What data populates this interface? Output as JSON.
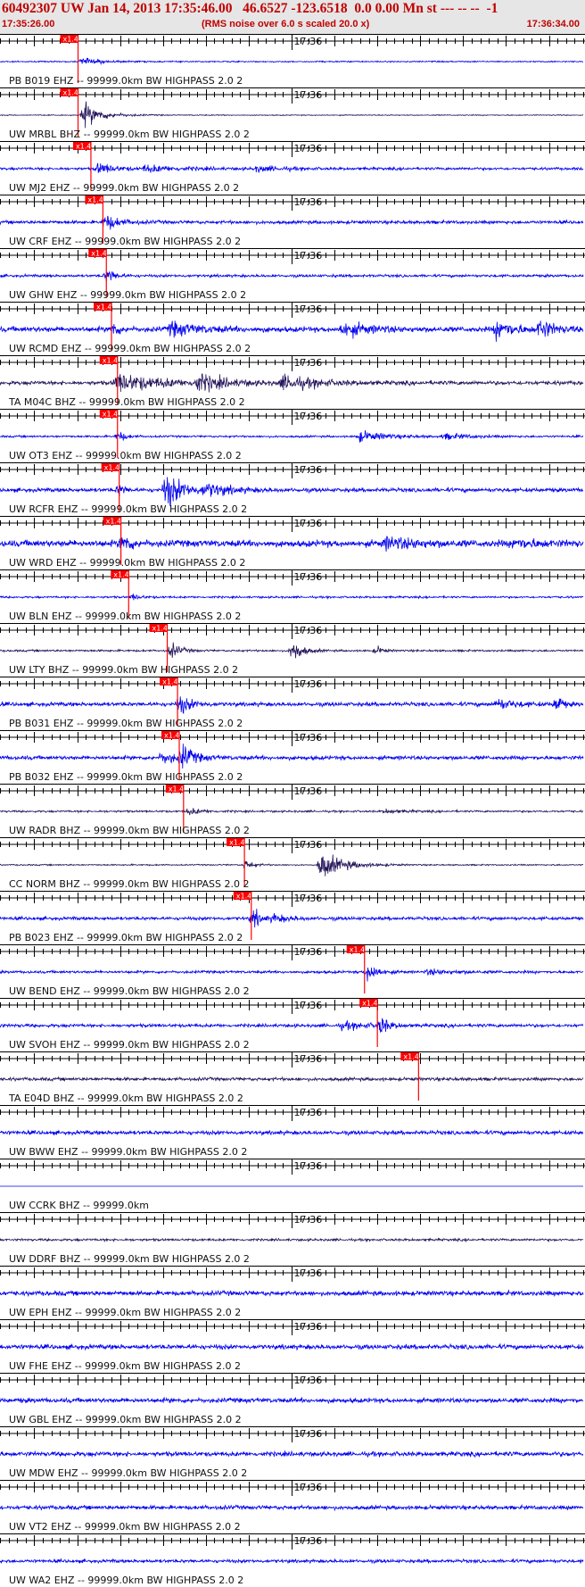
{
  "header": {
    "title": "60492307 UW Jan 14, 2013 17:35:46.00   46.6527 -123.6518  0.0 0.00 Mn st --- -- --  -1",
    "start_time": "17:35:26.00",
    "note": "(RMS noise over 6.0 s scaled 20.0 x)",
    "end_time": "17:36:34.00"
  },
  "colors": {
    "trace_blue": "#0000ee",
    "trace_dark": "#24145a",
    "pick": "#ff0000",
    "header_bg": "#e6e6e6",
    "header_text": "#c00000"
  },
  "chart_data": {
    "type": "line",
    "title": "60492307 UW Jan 14, 2013 17:35:46.00   46.6527 -123.6518  0.0 0.00 Mn st --- -- --  -1",
    "x_start": "17:35:26.00",
    "x_end": "17:36:34.00",
    "x_range_seconds": [
      0,
      68
    ],
    "minute_marker": {
      "label": "17:36",
      "seconds": 34
    },
    "pick_label": "x1.4",
    "grid": false,
    "series": [
      {
        "label": "PB B019 EHZ -- 99999.0km BW  HIGHPASS  2.0  2",
        "color": "blue",
        "noise": 1.0,
        "pick_s": 9.1,
        "bursts": [
          [
            9.6,
            6.0,
            2.0
          ]
        ]
      },
      {
        "label": "UW MRBL BHZ -- 99999.0km BW  HIGHPASS  2.0  2",
        "color": "dark",
        "noise": 0.7,
        "pick_s": 9.1,
        "bursts": [
          [
            9.9,
            18.0,
            2.0
          ]
        ]
      },
      {
        "label": "UW MJ2 EHZ -- 99999.0km BW  HIGHPASS  2.0  2",
        "color": "blue",
        "noise": 2.0,
        "pick_s": 10.6,
        "bursts": [
          [
            11.5,
            8.0,
            2.0
          ],
          [
            17.0,
            5.0,
            4.0
          ],
          [
            30.0,
            4.0,
            3.0
          ]
        ]
      },
      {
        "label": "UW CRF EHZ -- 99999.0km BW  HIGHPASS  2.0  2",
        "color": "blue",
        "noise": 2.5,
        "pick_s": 12.0,
        "bursts": [
          [
            12.3,
            12.0,
            1.5
          ]
        ]
      },
      {
        "label": "UW GHW EHZ -- 99999.0km BW  HIGHPASS  2.0  2",
        "color": "blue",
        "noise": 2.0,
        "pick_s": 12.4,
        "bursts": [
          [
            12.6,
            12.0,
            0.8
          ]
        ]
      },
      {
        "label": "UW RCMD EHZ -- 99999.0km BW  HIGHPASS  2.0  2",
        "color": "blue",
        "noise": 4.0,
        "pick_s": 13.0,
        "bursts": [
          [
            13.2,
            10.0,
            0.8
          ],
          [
            20.0,
            10.0,
            3.0
          ],
          [
            40.0,
            10.0,
            3.0
          ],
          [
            58.0,
            14.0,
            2.0
          ],
          [
            63.0,
            14.0,
            1.5
          ]
        ]
      },
      {
        "label": "TA M04C BHZ -- 99999.0km BW  HIGHPASS  2.0  2",
        "color": "dark",
        "noise": 3.0,
        "pick_s": 13.7,
        "bursts": [
          [
            13.7,
            14.0,
            5.0
          ],
          [
            23.0,
            12.0,
            3.0
          ],
          [
            33.0,
            10.0,
            4.0
          ]
        ]
      },
      {
        "label": "UW OT3 EHZ -- 99999.0km BW  HIGHPASS  2.0  2",
        "color": "blue",
        "noise": 1.5,
        "pick_s": 13.7,
        "bursts": [
          [
            13.9,
            8.0,
            0.8
          ],
          [
            42.0,
            8.0,
            3.0
          ],
          [
            52.0,
            4.0,
            3.0
          ]
        ]
      },
      {
        "label": "UW RCFR EHZ -- 99999.0km BW  HIGHPASS  2.0  2",
        "color": "blue",
        "noise": 3.0,
        "pick_s": 13.9,
        "bursts": [
          [
            14.0,
            10.0,
            0.5
          ],
          [
            19.4,
            26.0,
            2.0
          ],
          [
            24.0,
            8.0,
            3.0
          ]
        ]
      },
      {
        "label": "UW WRD EHZ -- 99999.0km BW  HIGHPASS  2.0  2",
        "color": "blue",
        "noise": 5.0,
        "pick_s": 14.1,
        "bursts": [
          [
            14.3,
            14.0,
            1.0
          ],
          [
            45.0,
            8.0,
            4.0
          ],
          [
            60.0,
            6.0,
            3.0
          ]
        ]
      },
      {
        "label": "UW BLN EHZ -- 99999.0km BW  HIGHPASS  2.0  2",
        "color": "blue",
        "noise": 1.5,
        "pick_s": 15.0,
        "bursts": [
          [
            15.5,
            4.0,
            1.0
          ]
        ]
      },
      {
        "label": "UW LTY BHZ -- 99999.0km BW  HIGHPASS  2.0  2",
        "color": "dark",
        "noise": 1.5,
        "pick_s": 19.5,
        "bursts": [
          [
            20.0,
            12.0,
            1.0
          ],
          [
            34.2,
            18.0,
            1.0
          ],
          [
            44.0,
            6.0,
            0.6
          ]
        ]
      },
      {
        "label": "PB B031 EHZ -- 99999.0km BW  HIGHPASS  2.0  2",
        "color": "blue",
        "noise": 3.0,
        "pick_s": 20.7,
        "bursts": [
          [
            21.0,
            14.0,
            1.2
          ],
          [
            58.0,
            8.0,
            2.0
          ],
          [
            65.0,
            16.0,
            0.5
          ]
        ]
      },
      {
        "label": "PB B032 EHZ -- 99999.0km BW  HIGHPASS  2.0  2",
        "color": "blue",
        "noise": 3.0,
        "pick_s": 20.9,
        "bursts": [
          [
            21.3,
            16.0,
            1.2
          ],
          [
            19.0,
            8.0,
            2.0
          ]
        ]
      },
      {
        "label": "UW RADR BHZ -- 99999.0km BW  HIGHPASS  2.0  2",
        "color": "dark",
        "noise": 1.5,
        "pick_s": 21.4,
        "bursts": [
          [
            22.0,
            5.0,
            1.5
          ],
          [
            45.0,
            3.0,
            2.0
          ]
        ]
      },
      {
        "label": "CC NORM BHZ -- 99999.0km BW  HIGHPASS  2.0  2",
        "color": "dark",
        "noise": 1.0,
        "pick_s": 28.5,
        "bursts": [
          [
            28.7,
            8.0,
            0.8
          ],
          [
            37.5,
            20.0,
            2.5
          ]
        ]
      },
      {
        "label": "PB B023 EHZ -- 99999.0km BW  HIGHPASS  2.0  2",
        "color": "blue",
        "noise": 2.5,
        "pick_s": 29.3,
        "bursts": [
          [
            29.6,
            14.0,
            0.8
          ],
          [
            32.0,
            5.0,
            2.0
          ]
        ]
      },
      {
        "label": "UW BEND EHZ -- 99999.0km BW  HIGHPASS  2.0  2",
        "color": "blue",
        "noise": 2.0,
        "pick_s": 42.5,
        "bursts": [
          [
            43.0,
            16.0,
            1.0
          ],
          [
            50.0,
            4.0,
            3.0
          ]
        ]
      },
      {
        "label": "UW SVOH EHZ -- 99999.0km BW  HIGHPASS  2.0  2",
        "color": "blue",
        "noise": 2.5,
        "pick_s": 44.0,
        "bursts": [
          [
            44.4,
            14.0,
            0.8
          ],
          [
            40.0,
            5.0,
            3.0
          ]
        ]
      },
      {
        "label": "TA E04D BHZ -- 99999.0km BW  HIGHPASS  2.0  2",
        "color": "dark",
        "noise": 2.5,
        "pick_s": 48.8,
        "bursts": []
      },
      {
        "label": "UW BWW EHZ -- 99999.0km BW  HIGHPASS  2.0  2",
        "color": "blue",
        "noise": 3.0,
        "pick_s": null,
        "bursts": []
      },
      {
        "label": "UW CCRK BHZ -- 99999.0km",
        "color": "blue",
        "noise": 0.0,
        "pick_s": null,
        "bursts": []
      },
      {
        "label": "UW DDRF BHZ -- 99999.0km BW  HIGHPASS  2.0  2",
        "color": "dark",
        "noise": 1.8,
        "pick_s": null,
        "bursts": []
      },
      {
        "label": "UW EPH EHZ -- 99999.0km BW  HIGHPASS  2.0  2",
        "color": "blue",
        "noise": 3.5,
        "pick_s": null,
        "bursts": []
      },
      {
        "label": "UW FHE EHZ -- 99999.0km BW  HIGHPASS  2.0  2",
        "color": "blue",
        "noise": 3.5,
        "pick_s": null,
        "bursts": []
      },
      {
        "label": "UW GBL EHZ -- 99999.0km BW  HIGHPASS  2.0  2",
        "color": "blue",
        "noise": 3.5,
        "pick_s": null,
        "bursts": []
      },
      {
        "label": "UW MDW EHZ -- 99999.0km BW  HIGHPASS  2.0  2",
        "color": "blue",
        "noise": 3.5,
        "pick_s": null,
        "bursts": []
      },
      {
        "label": "UW VT2 EHZ -- 99999.0km BW  HIGHPASS  2.0  2",
        "color": "blue",
        "noise": 3.0,
        "pick_s": null,
        "bursts": []
      },
      {
        "label": "UW WA2 EHZ -- 99999.0km BW  HIGHPASS  2.0  2",
        "color": "blue",
        "noise": 2.5,
        "pick_s": null,
        "bursts": []
      }
    ]
  }
}
